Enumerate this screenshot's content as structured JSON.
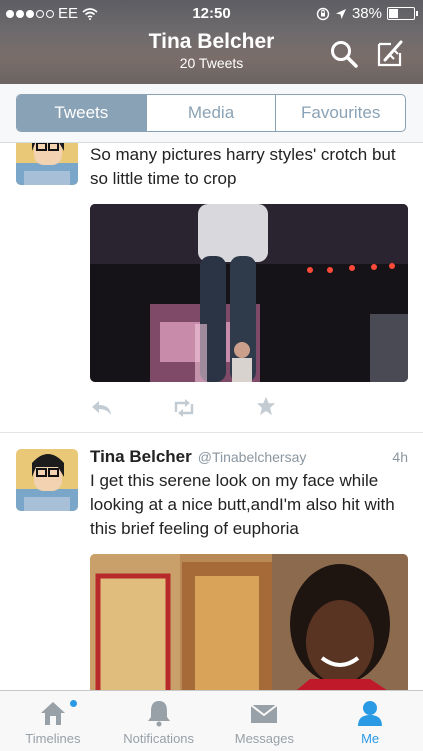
{
  "status_bar": {
    "carrier": "EE",
    "time": "12:50",
    "battery": "38%",
    "battery_level": 0.38
  },
  "header": {
    "title": "Tina Belcher",
    "subtitle": "20 Tweets"
  },
  "segments": [
    {
      "label": "Tweets",
      "active": true
    },
    {
      "label": "Media",
      "active": false
    },
    {
      "label": "Favourites",
      "active": false
    }
  ],
  "tweets": [
    {
      "text": "So many pictures harry styles' crotch but so little time to crop"
    },
    {
      "name": "Tina Belcher",
      "handle": "@Tinabelchersay",
      "time": "4h",
      "text": "I get this serene look on my face while looking at a nice butt,andI'm also hit with this brief feeling of euphoria"
    }
  ],
  "tabs": [
    {
      "label": "Timelines",
      "icon": "home-icon"
    },
    {
      "label": "Notifications",
      "icon": "bell-icon"
    },
    {
      "label": "Messages",
      "icon": "envelope-icon"
    },
    {
      "label": "Me",
      "icon": "person-icon",
      "active": true
    }
  ],
  "colors": {
    "accent": "#2b9ae5",
    "segment": "#8aa2b5"
  }
}
